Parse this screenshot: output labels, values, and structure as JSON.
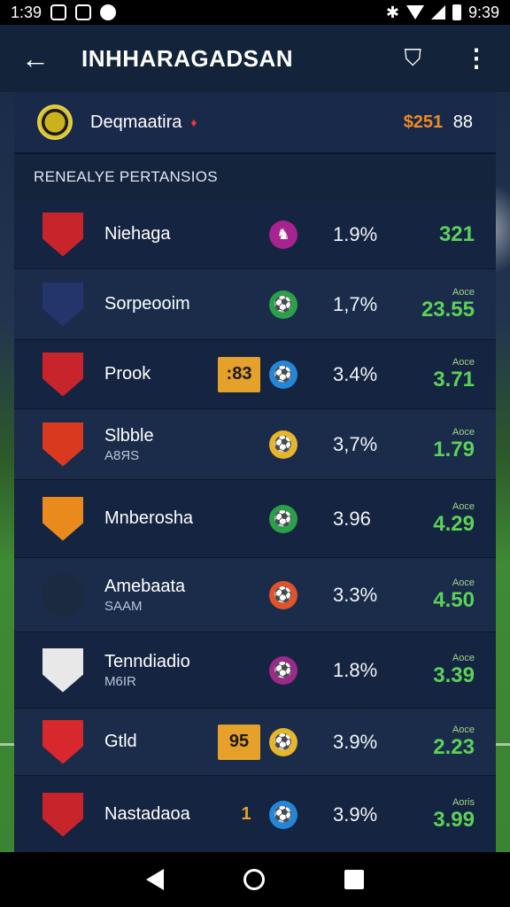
{
  "status_bar": {
    "time_left": "1:39",
    "time_right": "9:39"
  },
  "app_bar": {
    "title": "INHHARAGADSAN"
  },
  "header": {
    "team": "Deqmaatira",
    "price": "$251",
    "count": "88"
  },
  "section_title": "RENEALYE PERTANSIOS",
  "rows": [
    {
      "name": "Niehaga",
      "sub": "",
      "badge": "",
      "pct": "1.9%",
      "odds_label": "",
      "odds": "321",
      "crest_color": "#c8242b",
      "icon_color": "#a7238f",
      "icon": "♞"
    },
    {
      "name": "Sorpeooim",
      "sub": "",
      "badge": "",
      "pct": "1,7%",
      "odds_label": "Aoce",
      "odds": "23.55",
      "crest_color": "#24356b",
      "icon_color": "#2aa048",
      "icon": "⚽"
    },
    {
      "name": "Prook",
      "sub": "",
      "badge": ":83",
      "pct": "3.4%",
      "odds_label": "Aoce",
      "odds": "3.71",
      "crest_color": "#c8242b",
      "icon_color": "#2386d6",
      "icon": "⚽"
    },
    {
      "name": "Slbble",
      "sub": "A8ЯS",
      "badge": "",
      "pct": "3,7%",
      "odds_label": "Aoce",
      "odds": "1.79",
      "crest_color": "#d93a1f",
      "icon_color": "#e6b52a",
      "icon": "⚽"
    },
    {
      "name": "Mnberosha",
      "sub": "",
      "badge": "",
      "pct": "3.96",
      "odds_label": "Aoce",
      "odds": "4.29",
      "crest_color": "#e98a1c",
      "icon_color": "#2aa048",
      "icon": "⚽"
    },
    {
      "name": "Amebaata",
      "sub": "SAAM",
      "badge": "",
      "pct": "3.3%",
      "odds_label": "Aoce",
      "odds": "4.50",
      "crest_color": "#1b2a3f",
      "icon_color": "#e0522a",
      "icon": "⚽"
    },
    {
      "name": "Tenndiadio",
      "sub": "M6IR",
      "badge": "",
      "pct": "1.8%",
      "odds_label": "Aoce",
      "odds": "3.39",
      "crest_color": "#e8e8e8",
      "icon_color": "#9c2a8a",
      "icon": "⚽"
    },
    {
      "name": "Gtld",
      "sub": "",
      "badge": "95",
      "pct": "3.9%",
      "odds_label": "Aoce",
      "odds": "2.23",
      "crest_color": "#d8272d",
      "icon_color": "#e6b52a",
      "icon": "⚽"
    },
    {
      "name": "Nastadaoa",
      "sub": "",
      "badge": "1",
      "pct": "3.9%",
      "odds_label": "Aoris",
      "odds": "3.99",
      "crest_color": "#c8242b",
      "icon_color": "#2386d6",
      "icon": "⚽"
    }
  ]
}
